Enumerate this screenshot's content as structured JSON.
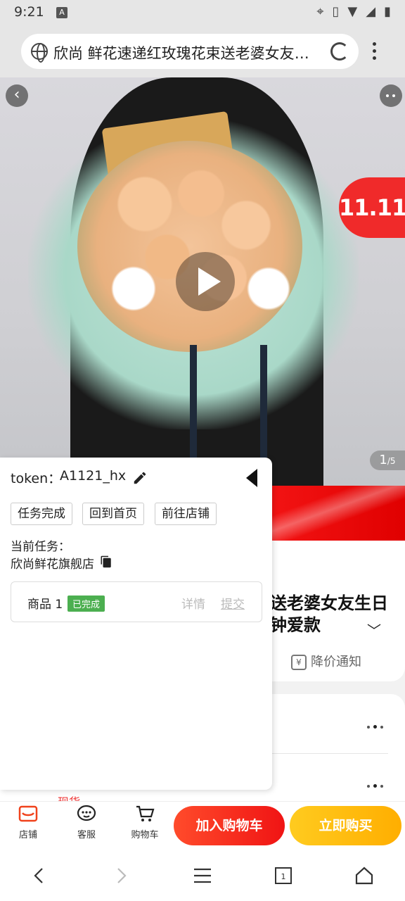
{
  "status_bar": {
    "time": "9:21",
    "app_icon": "A"
  },
  "url_bar": {
    "title": "欣尚 鲜花速递红玫瑰花束送老婆女友生日一小时同城配送",
    "icons": [
      "globe-icon",
      "reload-icon",
      "menu-dots-icon"
    ]
  },
  "hero": {
    "page_current": "1",
    "page_total": "/5",
    "promo_badge": "11.11"
  },
  "product": {
    "title_line1": "送老婆女友生日",
    "title_line2": "钟爱款",
    "price_notice": "降价通知",
    "stock_label": "现货"
  },
  "panel": {
    "token_label": "token：",
    "token_value": "A1121_hx",
    "buttons": [
      "任务完成",
      "回到首页",
      "前往店铺"
    ],
    "task_label": "当前任务：",
    "task_value": "欣尚鲜花旗舰店",
    "goods": {
      "name": "商品 1",
      "status": "已完成",
      "detail": "详情",
      "submit": "提交"
    }
  },
  "action_bar": {
    "tabs": [
      {
        "label": "店铺",
        "icon": "shop-icon"
      },
      {
        "label": "客服",
        "icon": "customer-service-icon"
      },
      {
        "label": "购物车",
        "icon": "cart-icon"
      }
    ],
    "add_to_cart": "加入购物车",
    "buy_now": "立即购买"
  },
  "colors": {
    "red": "#f01414",
    "yellow": "#ffb400",
    "green_tag": "#4caf50"
  }
}
